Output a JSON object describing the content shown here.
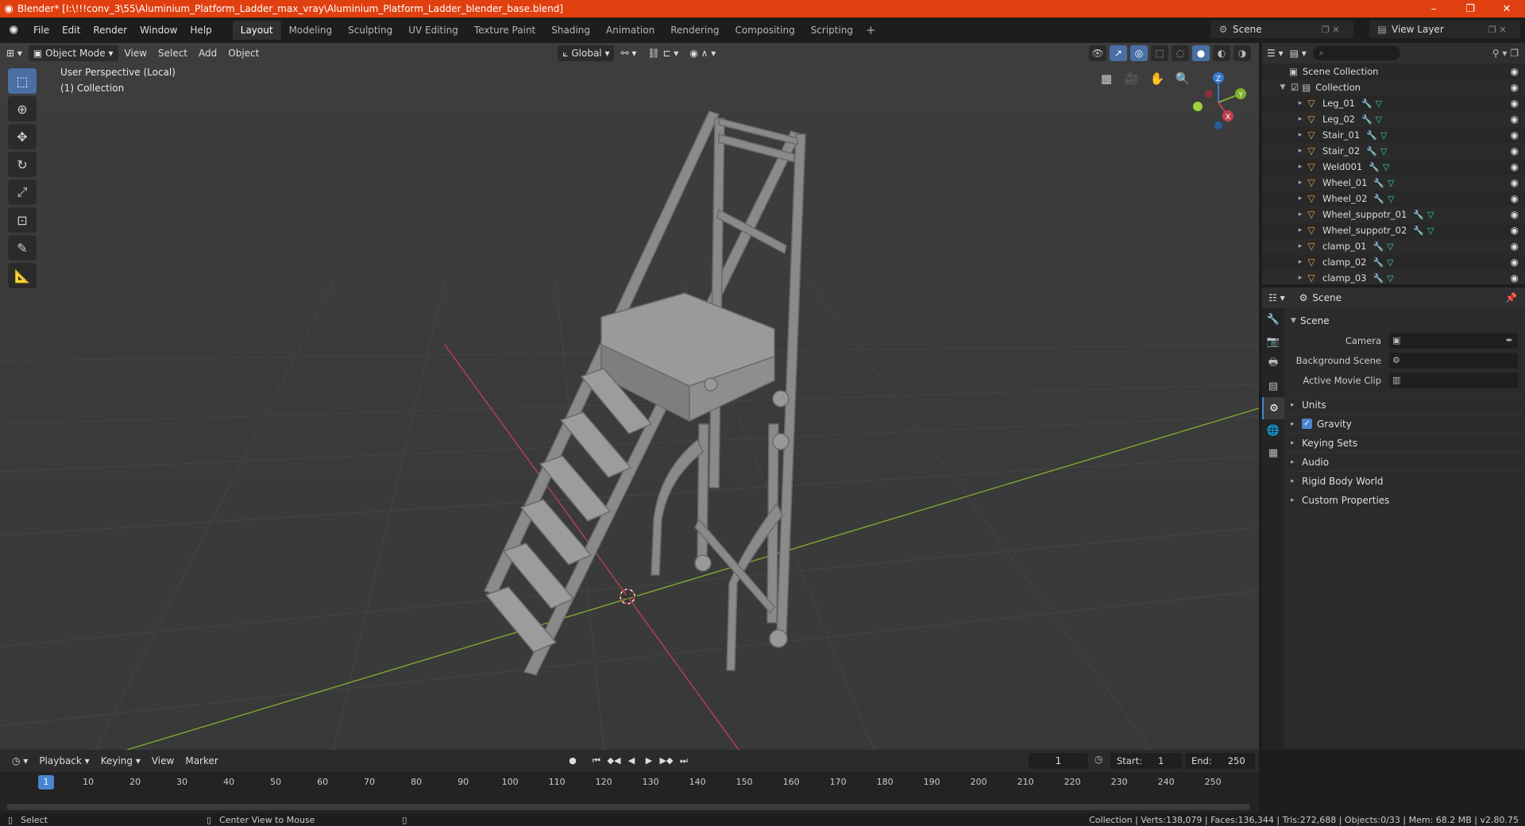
{
  "window": {
    "title": "Blender* [I:\\!!!conv_3\\55\\Aluminium_Platform_Ladder_max_vray\\Aluminium_Platform_Ladder_blender_base.blend]",
    "minimize": "–",
    "maximize": "❐",
    "close": "✕"
  },
  "menu": [
    "File",
    "Edit",
    "Render",
    "Window",
    "Help"
  ],
  "workspaces": [
    "Layout",
    "Modeling",
    "Sculpting",
    "UV Editing",
    "Texture Paint",
    "Shading",
    "Animation",
    "Rendering",
    "Compositing",
    "Scripting"
  ],
  "active_workspace": "Layout",
  "scene_name": "Scene",
  "view_layer": "View Layer",
  "viewport": {
    "mode": "Object Mode",
    "menus": [
      "View",
      "Select",
      "Add",
      "Object"
    ],
    "orientation": "Global",
    "perspective_label": "User Perspective (Local)",
    "collection_label": "(1) Collection",
    "gizmo_axes": {
      "z": "Z",
      "y": "Y",
      "x": "X"
    }
  },
  "outliner": {
    "root": "Scene Collection",
    "collection": "Collection",
    "objects": [
      "Leg_01",
      "Leg_02",
      "Stair_01",
      "Stair_02",
      "Weld001",
      "Wheel_01",
      "Wheel_02",
      "Wheel_suppotr_01",
      "Wheel_suppotr_02",
      "clamp_01",
      "clamp_02",
      "clamp_03"
    ]
  },
  "properties": {
    "header": "Scene",
    "panel": "Scene",
    "camera_label": "Camera",
    "background_scene_label": "Background Scene",
    "active_clip_label": "Active Movie Clip",
    "subpanels": [
      "Units",
      "Gravity",
      "Keying Sets",
      "Audio",
      "Rigid Body World",
      "Custom Properties"
    ]
  },
  "timeline": {
    "menus": [
      "Playback",
      "Keying",
      "View",
      "Marker"
    ],
    "current_frame": "1",
    "start_label": "Start:",
    "start": "1",
    "end_label": "End:",
    "end": "250",
    "ticks": [
      "10",
      "20",
      "30",
      "40",
      "50",
      "60",
      "70",
      "80",
      "90",
      "100",
      "110",
      "120",
      "130",
      "140",
      "150",
      "160",
      "170",
      "180",
      "190",
      "200",
      "210",
      "220",
      "230",
      "240",
      "250"
    ]
  },
  "status": {
    "left_action": "Select",
    "middle_action": "Center View to Mouse",
    "stats": "Collection | Verts:138,079 | Faces:136,344 | Tris:272,688 | Objects:0/33 | Mem: 68.2 MB | v2.80.75"
  },
  "colors": {
    "accent": "#4a86d0",
    "titlebar": "#e04010",
    "viewport_bg": "#3d3d3d",
    "x_axis": "#c04050",
    "y_axis": "#80b030",
    "z_axis": "#3a78d0"
  }
}
